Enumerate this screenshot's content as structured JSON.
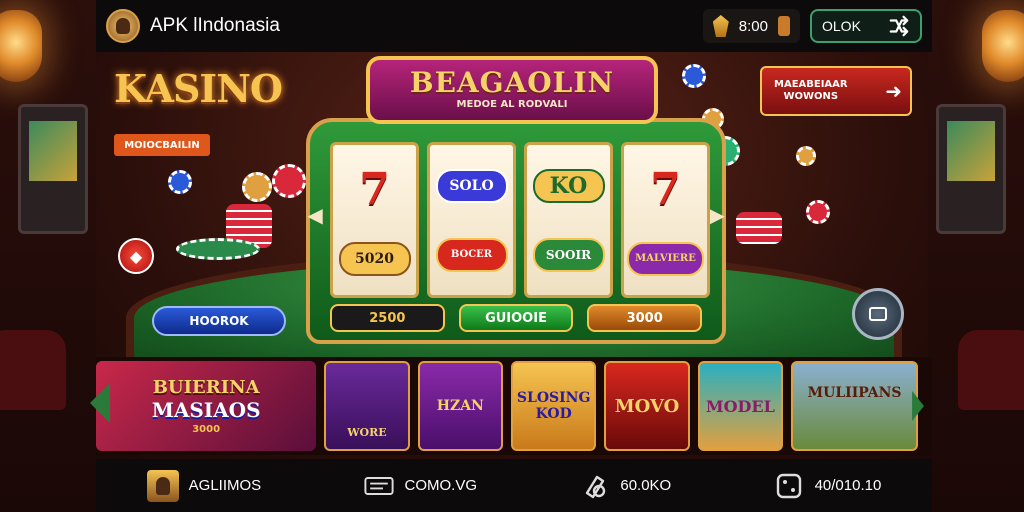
{
  "header": {
    "app_title": "APK lIndonasia",
    "balance": "8:00",
    "ok_label": "OLOK"
  },
  "promo": {
    "kasino_title": "KASINO",
    "kasino_sub": "MOIOCBAILIN",
    "right_button": "MAEABEIAAR\nWOWONS"
  },
  "machine": {
    "title": "BEAGAOLIN",
    "subtitle": "MEDOE AL RODVALI",
    "reels": [
      [
        "7",
        "5020"
      ],
      [
        "SOLO",
        "BOCER"
      ],
      [
        "KO",
        "SOOIR"
      ],
      [
        "7",
        "MALVIERE"
      ]
    ],
    "bets": [
      "2500",
      "GUIOOIE",
      "3000"
    ],
    "left_button": "HOOROK"
  },
  "games": {
    "featured": {
      "line1": "BUIERINA",
      "line2": "MASIAOS",
      "line3": "3000"
    },
    "tiles": [
      "WORE",
      "HZAN",
      "SLOSING KOD",
      "MOVO",
      "MODEL",
      "MULIIPANS"
    ]
  },
  "nav": [
    {
      "label": "AGLIIMOS",
      "icon": "avatar-icon"
    },
    {
      "label": "COMO.VG",
      "icon": "ticket-icon"
    },
    {
      "label": "60.0KO",
      "icon": "coin-icon"
    },
    {
      "label": "40/010.10",
      "icon": "dice-icon"
    }
  ],
  "colors": {
    "accent_gold": "#f5c451",
    "table_green": "#1e6a2a",
    "banner_purple": "#8a1a6a",
    "top_bar": "#0c0a0a"
  }
}
